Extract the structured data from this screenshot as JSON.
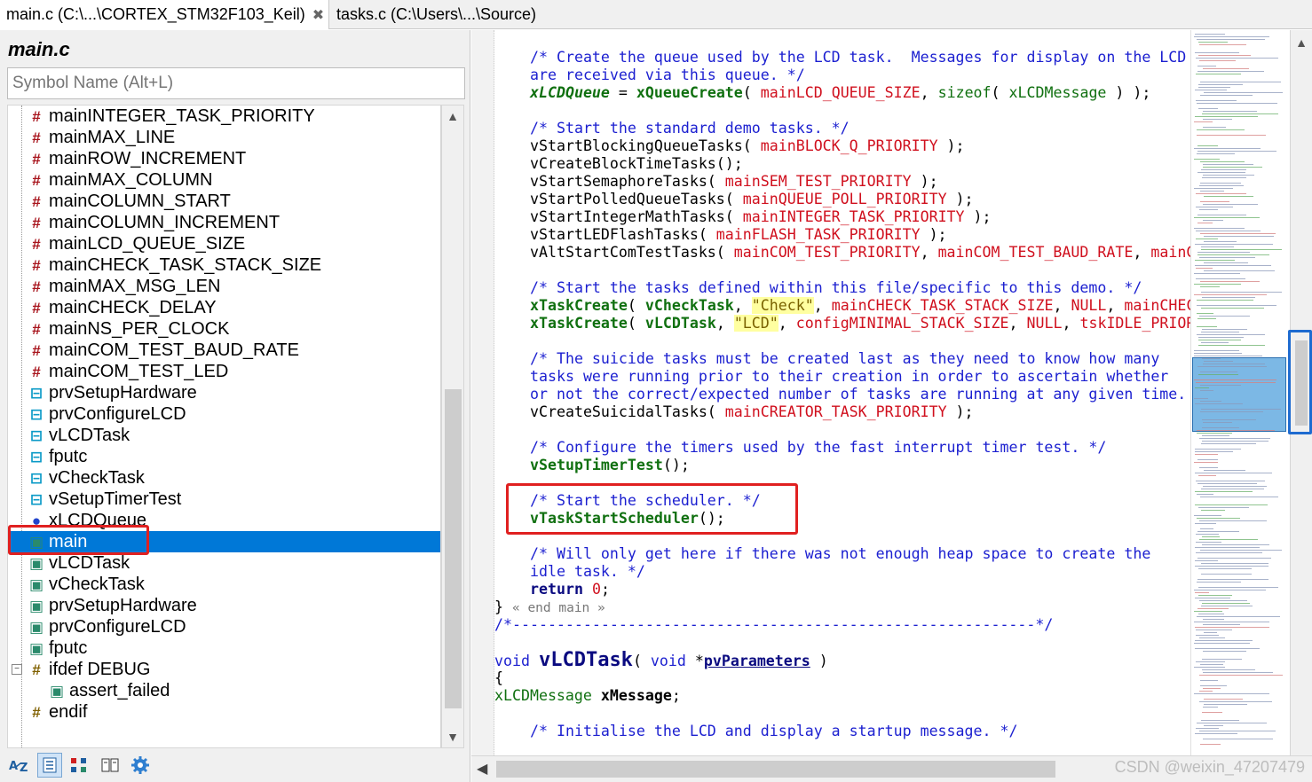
{
  "tabs": [
    {
      "label": "main.c (C:\\...\\CORTEX_STM32F103_Keil)",
      "close": "✖"
    },
    {
      "label": "tasks.c (C:\\Users\\...\\Source)"
    }
  ],
  "symbols_panel": {
    "title": "main.c",
    "search_placeholder": "Symbol Name (Alt+L)",
    "items": [
      {
        "label": "mainINTEGER_TASK_PRIORITY",
        "kind": "define"
      },
      {
        "label": "mainMAX_LINE",
        "kind": "define"
      },
      {
        "label": "mainROW_INCREMENT",
        "kind": "define"
      },
      {
        "label": "mainMAX_COLUMN",
        "kind": "define"
      },
      {
        "label": "mainCOLUMN_START",
        "kind": "define"
      },
      {
        "label": "mainCOLUMN_INCREMENT",
        "kind": "define"
      },
      {
        "label": "mainLCD_QUEUE_SIZE",
        "kind": "define"
      },
      {
        "label": "mainCHECK_TASK_STACK_SIZE",
        "kind": "define"
      },
      {
        "label": "mainMAX_MSG_LEN",
        "kind": "define"
      },
      {
        "label": "mainCHECK_DELAY",
        "kind": "define"
      },
      {
        "label": "mainNS_PER_CLOCK",
        "kind": "define"
      },
      {
        "label": "mainCOM_TEST_BAUD_RATE",
        "kind": "define"
      },
      {
        "label": "mainCOM_TEST_LED",
        "kind": "define"
      },
      {
        "label": "prvSetupHardware",
        "kind": "prototype"
      },
      {
        "label": "prvConfigureLCD",
        "kind": "prototype"
      },
      {
        "label": "vLCDTask",
        "kind": "prototype"
      },
      {
        "label": "fputc",
        "kind": "prototype"
      },
      {
        "label": "vCheckTask",
        "kind": "prototype"
      },
      {
        "label": "vSetupTimerTest",
        "kind": "prototype"
      },
      {
        "label": "xLCDQueue",
        "kind": "variable"
      },
      {
        "label": "main",
        "kind": "function",
        "selected": true
      },
      {
        "label": "vLCDTask",
        "kind": "function"
      },
      {
        "label": "vCheckTask",
        "kind": "function"
      },
      {
        "label": "prvSetupHardware",
        "kind": "function"
      },
      {
        "label": "prvConfigureLCD",
        "kind": "function"
      },
      {
        "label": "fputc",
        "kind": "function"
      },
      {
        "label": "ifdef DEBUG",
        "kind": "ifdef",
        "expanded": true
      },
      {
        "label": "assert_failed",
        "kind": "function",
        "indent": 1
      },
      {
        "label": "endif",
        "kind": "ifdef"
      }
    ],
    "toolbar": [
      "sort-az-icon",
      "list-view-icon",
      "category-view-icon",
      "book-icon",
      "gear-icon"
    ],
    "selected_color": "#0078d7"
  },
  "editor": {
    "lines": [
      {
        "indent": 1,
        "tokens": [
          {
            "t": "/* Create the queue used by the LCD task.  Messages for display on the LCD",
            "c": "comment"
          }
        ]
      },
      {
        "indent": 1,
        "tokens": [
          {
            "t": "are received via this queue. */",
            "c": "comment"
          }
        ]
      },
      {
        "indent": 1,
        "tokens": [
          {
            "t": "xLCDQueue",
            "c": "func-italic"
          },
          {
            "t": " = ",
            "c": ""
          },
          {
            "t": "xQueueCreate",
            "c": "func"
          },
          {
            "t": "( ",
            "c": ""
          },
          {
            "t": "mainLCD_QUEUE_SIZE",
            "c": "macro"
          },
          {
            "t": ", ",
            "c": ""
          },
          {
            "t": "sizeof",
            "c": "func-plain"
          },
          {
            "t": "( ",
            "c": ""
          },
          {
            "t": "xLCDMessage",
            "c": "func-plain"
          },
          {
            "t": " ) );",
            "c": ""
          }
        ]
      },
      {
        "indent": 1,
        "tokens": []
      },
      {
        "indent": 1,
        "tokens": [
          {
            "t": "/* Start the standard demo tasks. */",
            "c": "comment"
          }
        ]
      },
      {
        "indent": 1,
        "tokens": [
          {
            "t": "vStartBlockingQueueTasks( ",
            "c": ""
          },
          {
            "t": "mainBLOCK_Q_PRIORITY",
            "c": "macro"
          },
          {
            "t": " );",
            "c": ""
          }
        ]
      },
      {
        "indent": 1,
        "tokens": [
          {
            "t": "vCreateBlockTimeTasks();",
            "c": ""
          }
        ]
      },
      {
        "indent": 1,
        "tokens": [
          {
            "t": "vStartSemaphoreTasks( ",
            "c": ""
          },
          {
            "t": "mainSEM_TEST_PRIORITY",
            "c": "macro"
          },
          {
            "t": " );",
            "c": ""
          }
        ]
      },
      {
        "indent": 1,
        "tokens": [
          {
            "t": "vStartPolledQueueTasks( ",
            "c": ""
          },
          {
            "t": "mainQUEUE_POLL_PRIORITY",
            "c": "macro"
          },
          {
            "t": " );",
            "c": ""
          }
        ]
      },
      {
        "indent": 1,
        "tokens": [
          {
            "t": "vStartIntegerMathTasks( ",
            "c": ""
          },
          {
            "t": "mainINTEGER_TASK_PRIORITY",
            "c": "macro"
          },
          {
            "t": " );",
            "c": ""
          }
        ]
      },
      {
        "indent": 1,
        "tokens": [
          {
            "t": "vStartLEDFlashTasks( ",
            "c": ""
          },
          {
            "t": "mainFLASH_TASK_PRIORITY",
            "c": "macro"
          },
          {
            "t": " );",
            "c": ""
          }
        ]
      },
      {
        "indent": 1,
        "tokens": [
          {
            "t": "vAltStartComTestTasks( ",
            "c": ""
          },
          {
            "t": "mainCOM_TEST_PRIORITY",
            "c": "macro"
          },
          {
            "t": ", ",
            "c": ""
          },
          {
            "t": "mainCOM_TEST_BAUD_RATE",
            "c": "macro"
          },
          {
            "t": ", ",
            "c": ""
          },
          {
            "t": "mainC",
            "c": "macro"
          }
        ]
      },
      {
        "indent": 1,
        "tokens": []
      },
      {
        "indent": 1,
        "tokens": [
          {
            "t": "/* Start the tasks defined within this file/specific to this demo. */",
            "c": "comment"
          }
        ]
      },
      {
        "indent": 1,
        "tokens": [
          {
            "t": "xTaskCreate",
            "c": "func"
          },
          {
            "t": "( ",
            "c": ""
          },
          {
            "t": "vCheckTask",
            "c": "func"
          },
          {
            "t": ", ",
            "c": ""
          },
          {
            "t": "\"Check\"",
            "c": "str"
          },
          {
            "t": ", ",
            "c": ""
          },
          {
            "t": "mainCHECK_TASK_STACK_SIZE",
            "c": "macro"
          },
          {
            "t": ", ",
            "c": ""
          },
          {
            "t": "NULL",
            "c": "macro"
          },
          {
            "t": ", ",
            "c": ""
          },
          {
            "t": "mainCHEC",
            "c": "macro"
          }
        ]
      },
      {
        "indent": 1,
        "tokens": [
          {
            "t": "xTaskCreate",
            "c": "func"
          },
          {
            "t": "( ",
            "c": ""
          },
          {
            "t": "vLCDTask",
            "c": "func"
          },
          {
            "t": ", ",
            "c": ""
          },
          {
            "t": "\"LCD\"",
            "c": "str"
          },
          {
            "t": ", ",
            "c": ""
          },
          {
            "t": "configMINIMAL_STACK_SIZE",
            "c": "macro"
          },
          {
            "t": ", ",
            "c": ""
          },
          {
            "t": "NULL",
            "c": "macro"
          },
          {
            "t": ", ",
            "c": ""
          },
          {
            "t": "tskIDLE_PRIOR",
            "c": "macro"
          }
        ]
      },
      {
        "indent": 1,
        "tokens": []
      },
      {
        "indent": 1,
        "tokens": [
          {
            "t": "/* The suicide tasks must be created last as they need to know how many",
            "c": "comment"
          }
        ]
      },
      {
        "indent": 1,
        "tokens": [
          {
            "t": "tasks were running prior to their creation in order to ascertain whether",
            "c": "comment"
          }
        ]
      },
      {
        "indent": 1,
        "tokens": [
          {
            "t": "or not the correct/expected number of tasks are running at any given time.",
            "c": "comment"
          }
        ]
      },
      {
        "indent": 1,
        "tokens": [
          {
            "t": "vCreateSuicidalTasks( ",
            "c": ""
          },
          {
            "t": "mainCREATOR_TASK_PRIORITY",
            "c": "macro"
          },
          {
            "t": " );",
            "c": ""
          }
        ]
      },
      {
        "indent": 1,
        "tokens": []
      },
      {
        "indent": 1,
        "tokens": [
          {
            "t": "/* Configure the timers used by the fast interrupt timer test. */",
            "c": "comment"
          }
        ]
      },
      {
        "indent": 1,
        "tokens": [
          {
            "t": "vSetupTimerTest",
            "c": "func"
          },
          {
            "t": "();",
            "c": ""
          }
        ]
      },
      {
        "indent": 1,
        "tokens": []
      },
      {
        "indent": 1,
        "tokens": [
          {
            "t": "/* Start the scheduler. */",
            "c": "comment"
          }
        ]
      },
      {
        "indent": 1,
        "tokens": [
          {
            "t": "vTaskStartScheduler",
            "c": "func"
          },
          {
            "t": "();",
            "c": ""
          }
        ]
      },
      {
        "indent": 1,
        "tokens": []
      },
      {
        "indent": 1,
        "tokens": [
          {
            "t": "/* Will only get here if there was not enough heap space to create the",
            "c": "comment"
          }
        ]
      },
      {
        "indent": 1,
        "tokens": [
          {
            "t": "idle task. */",
            "c": "comment"
          }
        ]
      },
      {
        "indent": 1,
        "tokens": [
          {
            "t": "return",
            "c": "kw"
          },
          {
            "t": " ",
            "c": ""
          },
          {
            "t": "0",
            "c": "macro"
          },
          {
            "t": ";",
            "c": ""
          }
        ]
      },
      {
        "indent": 0,
        "tokens": [
          {
            "t": "} ",
            "c": ""
          },
          {
            "t": "« end main »",
            "c": "fold"
          }
        ]
      },
      {
        "indent": 0,
        "tokens": [
          {
            "t": "/*-----------------------------------------------------------*/",
            "c": "comment"
          }
        ]
      },
      {
        "indent": 0,
        "tokens": []
      },
      {
        "indent": 0,
        "tokens": [
          {
            "t": "void",
            "c": "type"
          },
          {
            "t": " ",
            "c": ""
          },
          {
            "t": "vLCDTask",
            "c": "big"
          },
          {
            "t": "( ",
            "c": ""
          },
          {
            "t": "void",
            "c": "type"
          },
          {
            "t": " *",
            "c": ""
          },
          {
            "t": "pvParameters",
            "c": "param"
          },
          {
            "t": " )",
            "c": ""
          }
        ]
      },
      {
        "indent": 0,
        "tokens": [
          {
            "t": "{",
            "c": ""
          }
        ]
      },
      {
        "indent": 0,
        "tokens": [
          {
            "t": "xLCDMessage",
            "c": "func-plain"
          },
          {
            "t": " ",
            "c": ""
          },
          {
            "t": "xMessage",
            "c": "bold"
          },
          {
            "t": ";",
            "c": ""
          }
        ]
      },
      {
        "indent": 0,
        "tokens": []
      },
      {
        "indent": 1,
        "tokens": [
          {
            "t": "/* Initialise the LCD and display a startup message. */",
            "c": "comment"
          }
        ]
      }
    ]
  },
  "watermark": "CSDN @weixin_47207479"
}
